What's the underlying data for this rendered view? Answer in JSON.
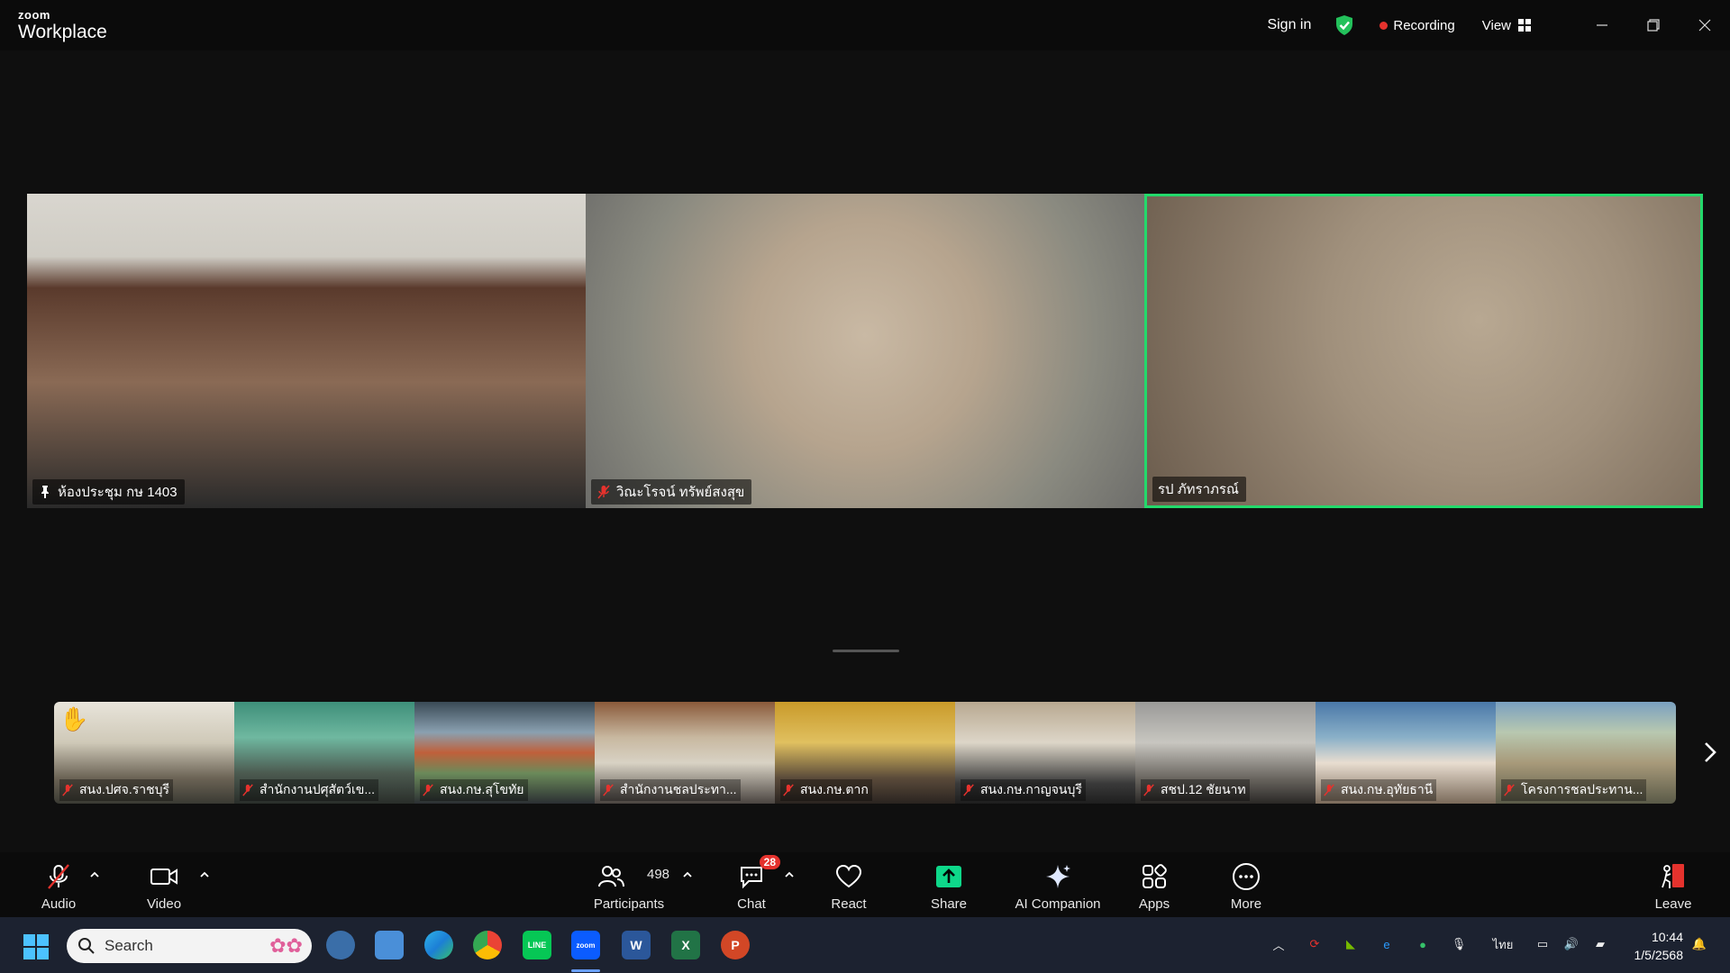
{
  "app": {
    "brand_small": "zoom",
    "brand_big": "Workplace"
  },
  "titlebar": {
    "sign_in": "Sign in",
    "recording": "Recording",
    "view": "View"
  },
  "speakers": [
    {
      "name": "ห้องประชุม กษ 1403",
      "pinned": true
    },
    {
      "name": "วิณะโรจน์ ทรัพย์สงสุข",
      "muted": true
    },
    {
      "name": "รป ภัทราภรณ์",
      "active": true
    }
  ],
  "gallery": [
    {
      "name": "สนง.ปศจ.ราชบุรี",
      "hand_raised": true
    },
    {
      "name": "สำนักงานปศุสัตว์เข..."
    },
    {
      "name": "สนง.กษ.สุโขทัย"
    },
    {
      "name": "สำนักงานชลประทา..."
    },
    {
      "name": "สนง.กษ.ตาก"
    },
    {
      "name": "สนง.กษ.กาญจนบุรี"
    },
    {
      "name": "สชป.12 ชัยนาท"
    },
    {
      "name": "สนง.กษ.อุทัยธานี"
    },
    {
      "name": "โครงการชลประทาน..."
    }
  ],
  "toolbar": {
    "audio": "Audio",
    "video": "Video",
    "participants": "Participants",
    "participants_count": "498",
    "chat": "Chat",
    "chat_badge": "28",
    "react": "React",
    "share": "Share",
    "ai_companion": "AI Companion",
    "apps": "Apps",
    "more": "More",
    "leave": "Leave"
  },
  "taskbar": {
    "search_placeholder": "Search",
    "language": "ไทย",
    "time": "10:44",
    "date": "1/5/2568"
  },
  "colors": {
    "active_speaker": "#23d96b",
    "recording": "#e5322d",
    "share": "#0ed88a",
    "leave": "#e5322d"
  }
}
